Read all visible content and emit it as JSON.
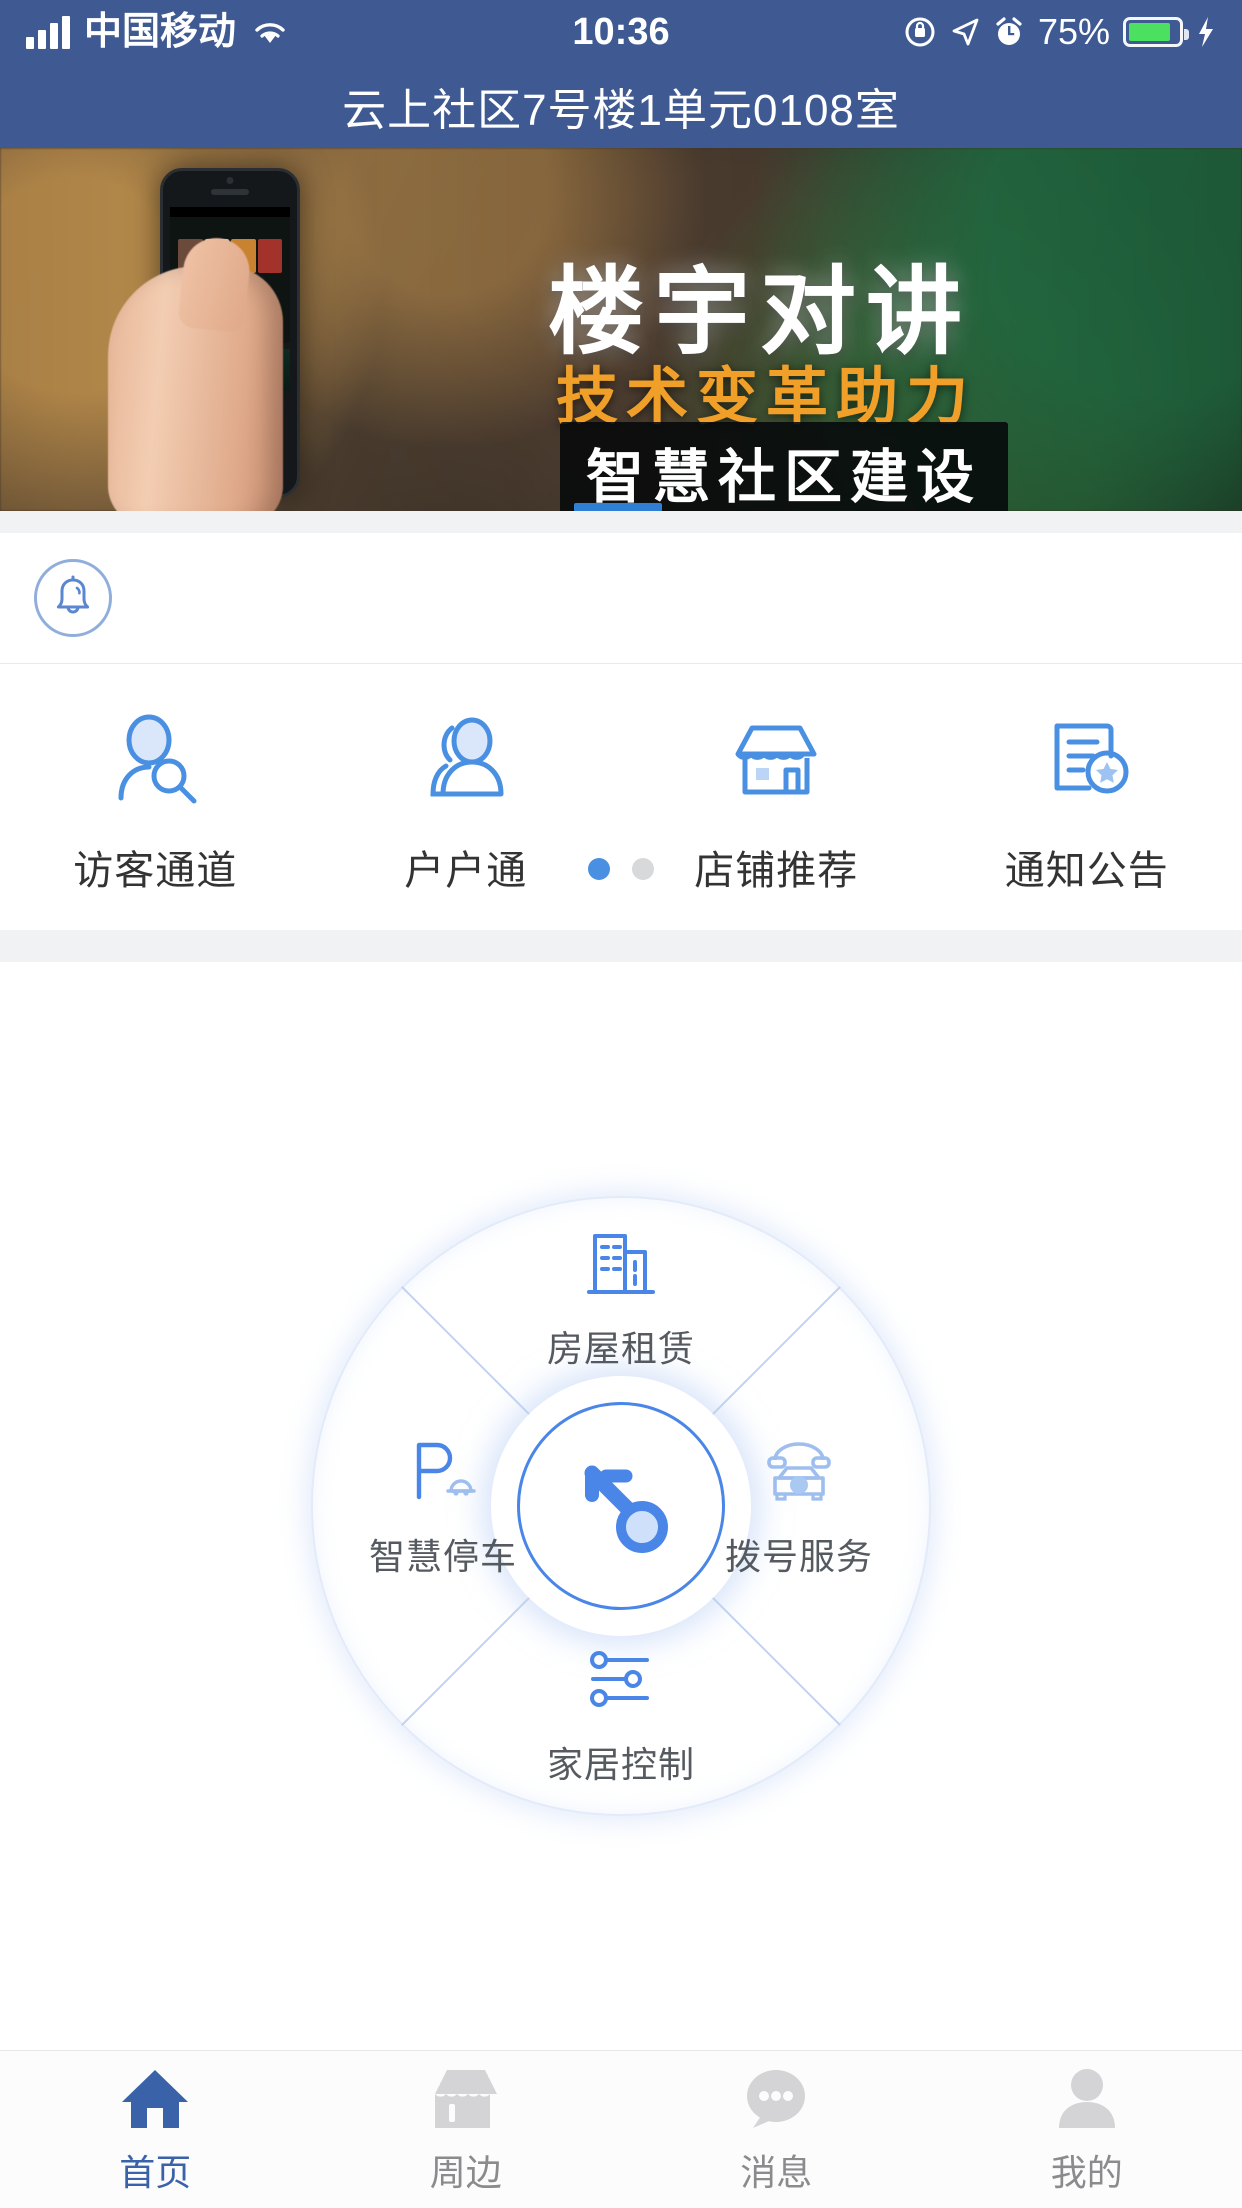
{
  "theme": {
    "header_blue": "#3F5A92",
    "accent_blue": "#4A86E8",
    "icon_blue": "#4A90E2",
    "icon_fill_light": "#D7E4FA",
    "banner_orange": "#F0A028",
    "gray_bg": "#F1F2F4",
    "inactive_gray": "#D4D4D6"
  },
  "status_bar": {
    "carrier": "中国移动",
    "signal_icon": "signal-bars-icon",
    "wifi_icon": "wifi-icon",
    "time": "10:36",
    "rotation_lock_icon": "rotation-lock-icon",
    "location_icon": "location-arrow-icon",
    "alarm_icon": "alarm-clock-icon",
    "battery_percent": "75%",
    "battery_icon": "battery-icon",
    "charging_icon": "lightning-bolt-icon"
  },
  "header": {
    "title": "云上社区7号楼1单元0108室"
  },
  "banner": {
    "line1": "楼宇对讲",
    "line2": "技术变革助力",
    "line3": "智慧社区建设",
    "image_alt": "hand-holding-phone-photo"
  },
  "notice": {
    "bell_icon": "bell-icon"
  },
  "quick_actions": {
    "items": [
      {
        "label": "访客通道",
        "icon": "visitor-search-icon"
      },
      {
        "label": "户户通",
        "icon": "two-people-icon"
      },
      {
        "label": "店铺推荐",
        "icon": "storefront-icon"
      },
      {
        "label": "通知公告",
        "icon": "document-star-icon"
      }
    ],
    "pagination": {
      "total": 2,
      "active_index": 0
    }
  },
  "wheel": {
    "center": {
      "label": "",
      "icon": "key-icon"
    },
    "items": [
      {
        "position": "top",
        "label": "房屋租赁",
        "icon": "building-icon"
      },
      {
        "position": "right",
        "label": "拨号服务",
        "icon": "telephone-icon"
      },
      {
        "position": "bottom",
        "label": "家居控制",
        "icon": "sliders-icon"
      },
      {
        "position": "left",
        "label": "智慧停车",
        "icon": "parking-car-icon"
      }
    ]
  },
  "tabbar": {
    "active_index": 0,
    "items": [
      {
        "label": "首页",
        "icon": "home-icon"
      },
      {
        "label": "周边",
        "icon": "storefront-icon"
      },
      {
        "label": "消息",
        "icon": "chat-bubble-icon"
      },
      {
        "label": "我的",
        "icon": "person-icon"
      }
    ]
  }
}
